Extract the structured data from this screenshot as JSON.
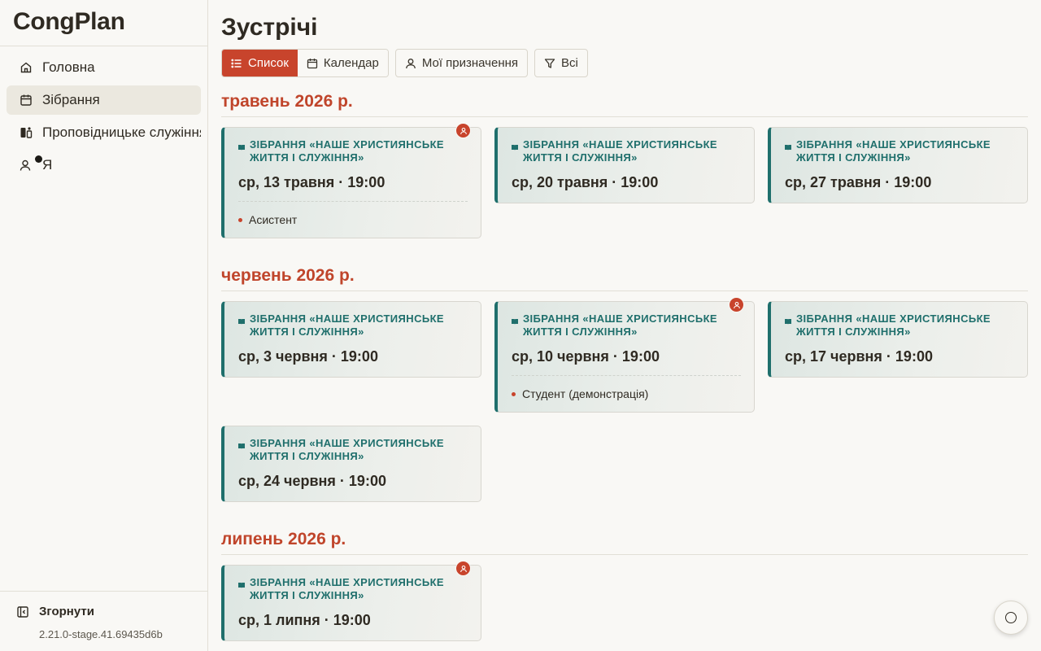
{
  "app": {
    "name": "CongPlan"
  },
  "sidebar": {
    "items": [
      {
        "label": "Головна",
        "icon": "home-icon"
      },
      {
        "label": "Зібрання",
        "icon": "calendar-icon",
        "active": true
      },
      {
        "label": "Проповідницьке служіння",
        "icon": "ministry-icon"
      },
      {
        "label": "Я",
        "icon": "user-icon",
        "notification_dot": true
      }
    ],
    "collapse_label": "Згорнути",
    "version": "2.21.0-stage.41.69435d6b"
  },
  "main": {
    "title": "Зустрічі",
    "toolbar": {
      "list_label": "Список",
      "calendar_label": "Календар",
      "my_assignments_label": "Мої призначення",
      "filter_label": "Всі"
    },
    "months": [
      {
        "label": "травень 2026 р.",
        "meetings": [
          {
            "title": "ЗІБРАННЯ «НАШЕ ХРИСТИЯНСЬКЕ ЖИТТЯ І СЛУЖІННЯ»",
            "date": "ср, 13 травня · 19:00",
            "assigned": true,
            "role": "Асистент"
          },
          {
            "title": "ЗІБРАННЯ «НАШЕ ХРИСТИЯНСЬКЕ ЖИТТЯ І СЛУЖІННЯ»",
            "date": "ср, 20 травня · 19:00"
          },
          {
            "title": "ЗІБРАННЯ «НАШЕ ХРИСТИЯНСЬКЕ ЖИТТЯ І СЛУЖІННЯ»",
            "date": "ср, 27 травня · 19:00"
          }
        ]
      },
      {
        "label": "червень 2026 р.",
        "meetings": [
          {
            "title": "ЗІБРАННЯ «НАШЕ ХРИСТИЯНСЬКЕ ЖИТТЯ І СЛУЖІННЯ»",
            "date": "ср, 3 червня · 19:00"
          },
          {
            "title": "ЗІБРАННЯ «НАШЕ ХРИСТИЯНСЬКЕ ЖИТТЯ І СЛУЖІННЯ»",
            "date": "ср, 10 червня · 19:00",
            "assigned": true,
            "role": "Студент (демонстрація)"
          },
          {
            "title": "ЗІБРАННЯ «НАШЕ ХРИСТИЯНСЬКЕ ЖИТТЯ І СЛУЖІННЯ»",
            "date": "ср, 17 червня · 19:00"
          },
          {
            "title": "ЗІБРАННЯ «НАШЕ ХРИСТИЯНСЬКЕ ЖИТТЯ І СЛУЖІННЯ»",
            "date": "ср, 24 червня · 19:00"
          }
        ]
      },
      {
        "label": "липень 2026 р.",
        "meetings": [
          {
            "title": "ЗІБРАННЯ «НАШЕ ХРИСТИЯНСЬКЕ ЖИТТЯ І СЛУЖІННЯ»",
            "date": "ср, 1 липня · 19:00",
            "assigned": true
          }
        ]
      }
    ]
  },
  "colors": {
    "accent": "#c8442c",
    "teal": "#1f6f6c",
    "background": "#f9f8f5"
  }
}
